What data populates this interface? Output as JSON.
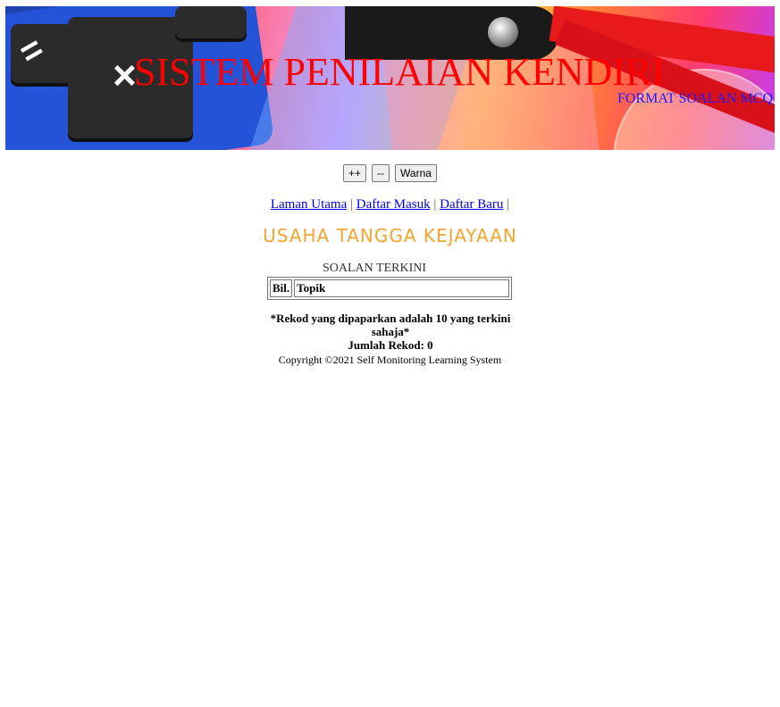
{
  "banner": {
    "title": "SISTEM PENILAIAN KENDIRI",
    "subtitle": "FORMAT SOALAN MCQ",
    "title_color": "#ff0000",
    "subtitle_color": "#1a1aff"
  },
  "controls": {
    "increase_label": "++",
    "decrease_label": "--",
    "color_label": "Warna"
  },
  "nav": {
    "items": [
      {
        "label": "Laman Utama"
      },
      {
        "label": "Daftar Masuk"
      },
      {
        "label": "Daftar Baru"
      }
    ],
    "separator": "|"
  },
  "heading": "USAHA TANGGA KEJAYAAN",
  "table": {
    "caption": "SOALAN TERKINI",
    "columns": [
      "Bil.",
      "Topik"
    ],
    "rows": []
  },
  "note": {
    "line1": "*Rekod yang dipaparkan adalah 10 yang terkini sahaja*",
    "count_text": "Jumlah Rekod: 0"
  },
  "footer": {
    "copyright": "Copyright ©2021 Self Monitoring Learning System"
  },
  "colors": {
    "heading": "#f2a531",
    "link": "#0000ee"
  }
}
